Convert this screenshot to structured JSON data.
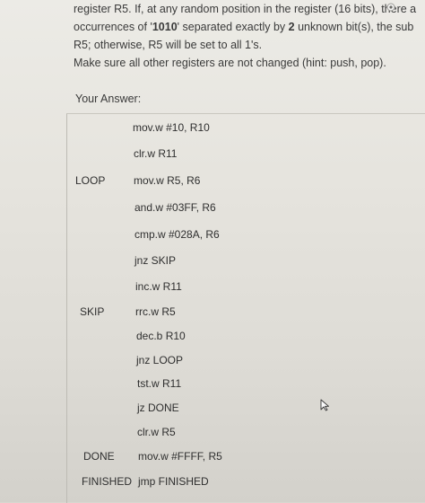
{
  "prompt": {
    "line1": "register R5. If, at any random position in the register (16 bits), there a",
    "line2_pre": "occurrences of '",
    "line2_bold1": "1010",
    "line2_mid": "' separated exactly by ",
    "line2_bold2": "2",
    "line2_post": " unknown bit(s), the sub",
    "line3": "R5; otherwise, R5 will be set to all 1's.",
    "line4": "Make sure all other registers are not changed (hint: push, pop)."
  },
  "answer_label": "Your Answer:",
  "code": [
    {
      "label": "",
      "instr": "mov.w #10, R10"
    },
    {
      "label": "",
      "instr": "clr.w R11"
    },
    {
      "label": "LOOP",
      "instr": "mov.w R5, R6"
    },
    {
      "label": "",
      "instr": "and.w #03FF, R6"
    },
    {
      "label": "",
      "instr": "cmp.w #028A, R6"
    },
    {
      "label": "",
      "instr": "jnz SKIP"
    },
    {
      "label": "",
      "instr": "inc.w R11"
    },
    {
      "label": "SKIP",
      "instr": "rrc.w R5"
    },
    {
      "label": "",
      "instr": "dec.b R10"
    },
    {
      "label": "",
      "instr": "jnz LOOP"
    },
    {
      "label": "",
      "instr": "tst.w R11"
    },
    {
      "label": "",
      "instr": "jz DONE"
    },
    {
      "label": "",
      "instr": "clr.w R5"
    },
    {
      "label": "DONE",
      "instr": "mov.w #FFFF, R5"
    },
    {
      "label": "FINISHED",
      "instr": "jmp FINISHED"
    }
  ],
  "icons": {
    "cursor": "mouse-pointer-icon",
    "dot": "radio-dot-icon"
  }
}
